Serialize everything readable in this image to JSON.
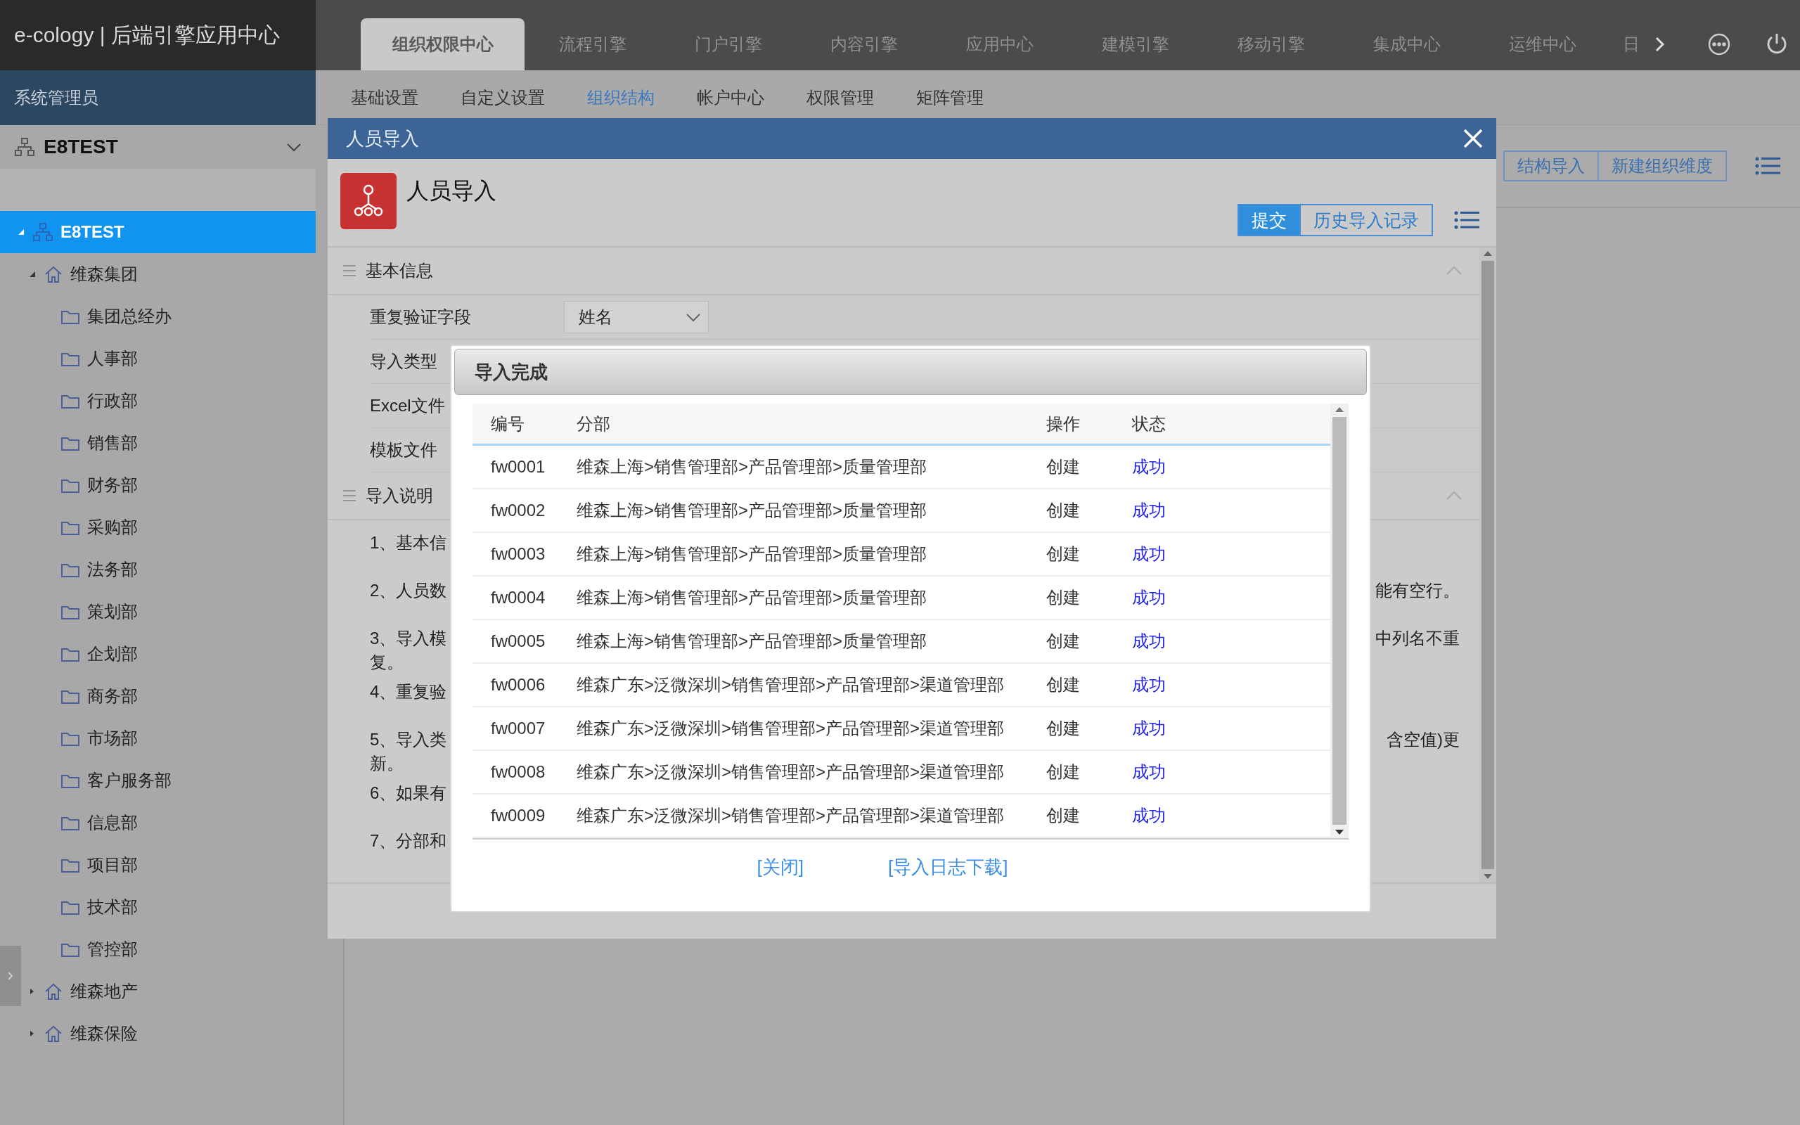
{
  "brand": "e-cology | 后端引擎应用中心",
  "user_bar": "系统管理员",
  "top_tabs": [
    {
      "label": "组织权限中心",
      "selected": true
    },
    {
      "label": "流程引擎",
      "selected": false
    },
    {
      "label": "门户引擎",
      "selected": false
    },
    {
      "label": "内容引擎",
      "selected": false
    },
    {
      "label": "应用中心",
      "selected": false
    },
    {
      "label": "建模引擎",
      "selected": false
    },
    {
      "label": "移动引擎",
      "selected": false
    },
    {
      "label": "集成中心",
      "selected": false
    },
    {
      "label": "运维中心",
      "selected": false
    },
    {
      "label": "日",
      "selected": false
    }
  ],
  "subnav": [
    {
      "label": "基础设置",
      "selected": false
    },
    {
      "label": "自定义设置",
      "selected": false
    },
    {
      "label": "组织结构",
      "selected": true
    },
    {
      "label": "帐户中心",
      "selected": false
    },
    {
      "label": "权限管理",
      "selected": false
    },
    {
      "label": "矩阵管理",
      "selected": false
    }
  ],
  "sidebar": {
    "org_selector": "E8TEST",
    "tree": [
      {
        "label": "E8TEST",
        "kind": "root",
        "selected": true,
        "expanded": true,
        "children": [
          {
            "label": "维森集团",
            "kind": "company",
            "selected": false,
            "expanded": true,
            "children": [
              {
                "label": "集团总经办",
                "kind": "dept",
                "selected": false
              },
              {
                "label": "人事部",
                "kind": "dept",
                "selected": false
              },
              {
                "label": "行政部",
                "kind": "dept",
                "selected": false
              },
              {
                "label": "销售部",
                "kind": "dept",
                "selected": false
              },
              {
                "label": "财务部",
                "kind": "dept",
                "selected": false
              },
              {
                "label": "采购部",
                "kind": "dept",
                "selected": false
              },
              {
                "label": "法务部",
                "kind": "dept",
                "selected": false
              },
              {
                "label": "策划部",
                "kind": "dept",
                "selected": false
              },
              {
                "label": "企划部",
                "kind": "dept",
                "selected": false
              },
              {
                "label": "商务部",
                "kind": "dept",
                "selected": false
              },
              {
                "label": "市场部",
                "kind": "dept",
                "selected": false
              },
              {
                "label": "客户服务部",
                "kind": "dept",
                "selected": false
              },
              {
                "label": "信息部",
                "kind": "dept",
                "selected": false
              },
              {
                "label": "项目部",
                "kind": "dept",
                "selected": false
              },
              {
                "label": "技术部",
                "kind": "dept",
                "selected": false
              },
              {
                "label": "管控部",
                "kind": "dept",
                "selected": false
              }
            ]
          },
          {
            "label": "维森地产",
            "kind": "company",
            "selected": false,
            "expanded": false
          },
          {
            "label": "维森保险",
            "kind": "company",
            "selected": false,
            "expanded": false
          }
        ]
      }
    ]
  },
  "background_toolbar": {
    "buttons": [
      "结构导入",
      "新建组织维度"
    ]
  },
  "dialog": {
    "title": "人员导入",
    "heading": "人员导入",
    "buttons": [
      {
        "label": "提交",
        "primary": true
      },
      {
        "label": "历史导入记录",
        "primary": false
      }
    ],
    "basic": {
      "title": "基本信息",
      "fields": [
        {
          "label": "重复验证字段",
          "value": "姓名"
        },
        {
          "label": "导入类型"
        },
        {
          "label": "Excel文件"
        },
        {
          "label": "模板文件"
        }
      ]
    },
    "notes": {
      "title": "导入说明",
      "items": [
        {
          "start": "1、基本信"
        },
        {
          "start": "2、人员数",
          "end": "能有空行。"
        },
        {
          "start": "3、导入模",
          "end": "中列名不重",
          "next_line": "复。"
        },
        {
          "start": "4、重复验"
        },
        {
          "start": "5、导入类",
          "end": "含空值)更",
          "next_line": "新。"
        },
        {
          "start": "6、如果有"
        },
        {
          "start": "7、分部和"
        }
      ]
    }
  },
  "popup": {
    "title": "导入完成",
    "columns": [
      "编号",
      "分部",
      "操作",
      "状态"
    ],
    "rows": [
      {
        "id": "fw0001",
        "branch": "维森上海>销售管理部>产品管理部>质量管理部",
        "action": "创建",
        "status": "成功"
      },
      {
        "id": "fw0002",
        "branch": "维森上海>销售管理部>产品管理部>质量管理部",
        "action": "创建",
        "status": "成功"
      },
      {
        "id": "fw0003",
        "branch": "维森上海>销售管理部>产品管理部>质量管理部",
        "action": "创建",
        "status": "成功"
      },
      {
        "id": "fw0004",
        "branch": "维森上海>销售管理部>产品管理部>质量管理部",
        "action": "创建",
        "status": "成功"
      },
      {
        "id": "fw0005",
        "branch": "维森上海>销售管理部>产品管理部>质量管理部",
        "action": "创建",
        "status": "成功"
      },
      {
        "id": "fw0006",
        "branch": "维森广东>泛微深圳>销售管理部>产品管理部>渠道管理部",
        "action": "创建",
        "status": "成功"
      },
      {
        "id": "fw0007",
        "branch": "维森广东>泛微深圳>销售管理部>产品管理部>渠道管理部",
        "action": "创建",
        "status": "成功"
      },
      {
        "id": "fw0008",
        "branch": "维森广东>泛微深圳>销售管理部>产品管理部>渠道管理部",
        "action": "创建",
        "status": "成功"
      },
      {
        "id": "fw0009",
        "branch": "维森广东>泛微深圳>销售管理部>产品管理部>渠道管理部",
        "action": "创建",
        "status": "成功"
      }
    ],
    "links": [
      "[关闭]",
      "[导入日志下载]"
    ]
  }
}
